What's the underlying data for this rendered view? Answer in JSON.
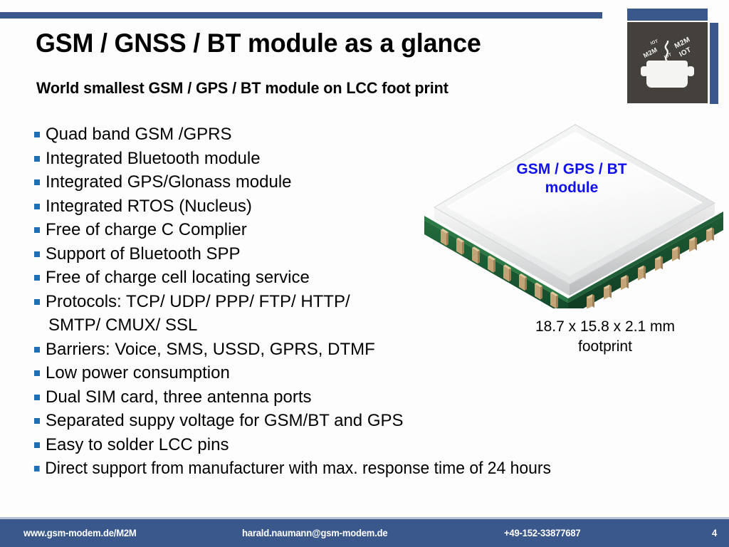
{
  "slide": {
    "title": "GSM / GNSS / BT module as a glance",
    "subtitle": "World smallest GSM / GPS / BT  module on LCC foot print",
    "page_number": "4"
  },
  "logo": {
    "name": "m2m-iot-pot-logo",
    "words": {
      "m2m_left": "M2M",
      "iot_small": "IOT",
      "m2m_right": "M2M",
      "iot_right": "IOT",
      "iot_mid": "IOT"
    }
  },
  "bullets": [
    {
      "text": "Quad band GSM /GPRS",
      "continuation": false
    },
    {
      "text": "Integrated Bluetooth module",
      "continuation": false
    },
    {
      "text": "Integrated GPS/Glonass module",
      "continuation": false
    },
    {
      "text": "Integrated RTOS (Nucleus)",
      "continuation": false
    },
    {
      "text": "Free of charge C Complier",
      "continuation": false
    },
    {
      "text": "Support of Bluetooth SPP",
      "continuation": false
    },
    {
      "text": "Free of charge cell locating service",
      "continuation": false
    },
    {
      "text": "Protocols: TCP/ UDP/ PPP/ FTP/ HTTP/",
      "continuation": false
    },
    {
      "text": "SMTP/ CMUX/ SSL",
      "continuation": true
    },
    {
      "text": "Barriers: Voice, SMS, USSD, GPRS, DTMF",
      "continuation": false
    },
    {
      "text": "Low power consumption",
      "continuation": false
    },
    {
      "text": "Dual SIM card, three antenna ports",
      "continuation": false
    },
    {
      "text": "Separated suppy voltage for GSM/BT and GPS",
      "continuation": false
    },
    {
      "text": "Easy to solder LCC pins",
      "continuation": false
    },
    {
      "text": "Direct support from manufacturer with max. response time of 24 hours",
      "continuation": false
    }
  ],
  "module_image": {
    "label_line1": "GSM / GPS / BT",
    "label_line2": "module",
    "caption_line1": "18.7 x 15.8 x 2.1 mm",
    "caption_line2": "footprint"
  },
  "footer": {
    "website": "www.gsm-modem.de/M2M",
    "email": "harald.naumann@gsm-modem.de",
    "phone": "+49-152-33877687",
    "page": "4"
  },
  "colors": {
    "brand_blue": "#3B588C",
    "bullet_blue": "#1F6FB5",
    "label_blue": "#1111ee",
    "pcb_green": "#1C5E34",
    "pin_gold": "#B99B6A",
    "logo_dark": "#44403B"
  }
}
